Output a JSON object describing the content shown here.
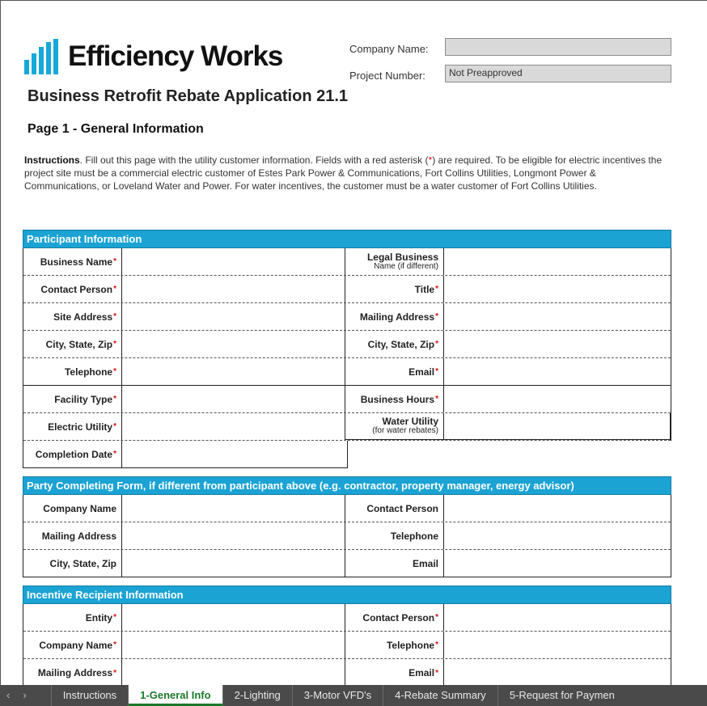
{
  "header": {
    "logo_text": "Efficiency Works",
    "app_title": "Business Retrofit Rebate Application 21.1",
    "company_name_label": "Company Name:",
    "company_name_value": "",
    "project_number_label": "Project Number:",
    "project_number_value": "Not Preapproved"
  },
  "page": {
    "title": "Page 1 - General Information",
    "instructions_bold": "Instructions",
    "instructions_text_1": ". Fill out this page with the utility customer information. Fields with a red asterisk (",
    "instructions_asterisk": "*",
    "instructions_text_2": ") are required. To be eligible for electric incentives the project site must be a commercial electric customer of Estes Park Power & Communications, Fort Collins Utilities, Longmont Power & Communications, or Loveland Water and Power. For water incentives, the customer must be a water customer of Fort Collins Utilities."
  },
  "participant": {
    "heading": "Participant Information",
    "business_name": "Business Name",
    "legal_name": "Legal Business",
    "legal_name_sub": "Name (if different)",
    "contact_person": "Contact Person",
    "title": "Title",
    "site_address": "Site Address",
    "mailing_address": "Mailing Address",
    "city_state_zip": "City, State, Zip",
    "city_state_zip_2": "City, State, Zip",
    "telephone": "Telephone",
    "email": "Email",
    "facility_type": "Facility Type",
    "business_hours": "Business Hours",
    "electric_utility": "Electric Utility",
    "water_utility": "Water Utility",
    "water_utility_sub": "(for water rebates)",
    "completion_date": "Completion Date",
    "asterisk": "*"
  },
  "party": {
    "heading": "Party Completing Form, if different from participant above (e.g. contractor, property manager, energy advisor)",
    "company_name": "Company Name",
    "contact_person": "Contact Person",
    "mailing_address": "Mailing Address",
    "telephone": "Telephone",
    "city_state_zip": "City, State, Zip",
    "email": "Email"
  },
  "recipient": {
    "heading": "Incentive Recipient Information",
    "entity": "Entity",
    "contact_person": "Contact Person",
    "company_name": "Company Name",
    "telephone": "Telephone",
    "mailing_address": "Mailing Address",
    "email": "Email"
  },
  "tabs": {
    "prev": "‹",
    "next": "›",
    "items": [
      "Instructions",
      "1-General Info",
      "2-Lighting",
      "3-Motor VFD's",
      "4-Rebate Summary",
      "5-Request for Paymen"
    ]
  },
  "colors": {
    "accent": "#1ba3d4",
    "active_tab": "#1b7a2b",
    "required": "#d11111"
  },
  "icons": {
    "logo": "efficiency-works-bars-icon"
  }
}
